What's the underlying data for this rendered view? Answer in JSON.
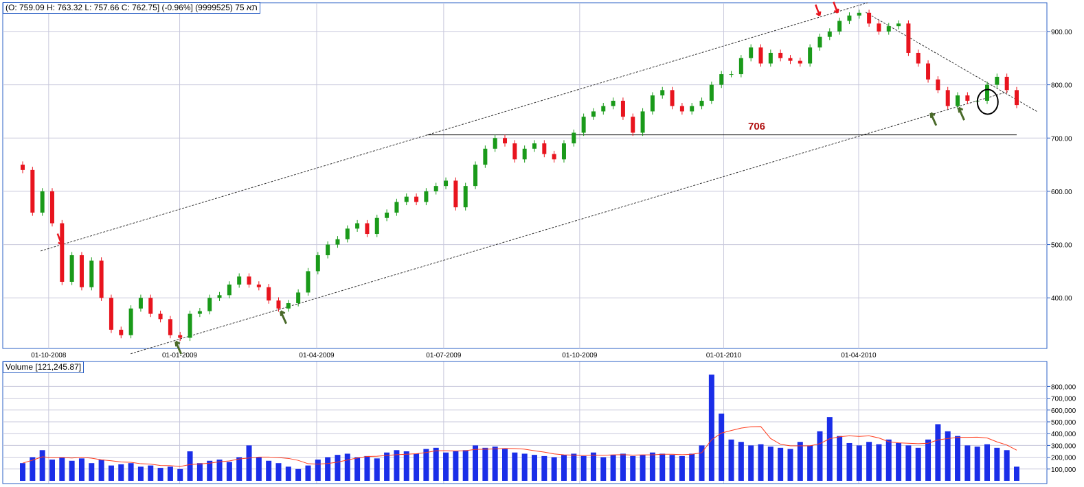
{
  "header": {
    "ohlc_readout": "(O: 759.09  H: 763.32  L: 757.66  C: 762.75] (-0.96%] (9999525) 75 תא"
  },
  "volume_panel": {
    "label": "Volume [121,245.87]"
  },
  "colors": {
    "up": "#1a9a1a",
    "down": "#e8141e",
    "grid": "#c8c8dc",
    "frame": "#2a5fc4",
    "volume": "#1a2ee8",
    "ma": "#ff3a1a",
    "annot": "#b01010"
  },
  "chart_data": [
    {
      "type": "candlestick",
      "title": "",
      "x_unit": "week index",
      "ylim": [
        305,
        954
      ],
      "xlim": [
        0,
        99.4
      ],
      "grid": true,
      "y_ticks": [
        400,
        500,
        600,
        700,
        800,
        900
      ],
      "y_tick_labels": [
        "400.00",
        "500.00",
        "600.00",
        "700.00",
        "800.00",
        "900.00"
      ],
      "x_ticks": [
        {
          "at": 2.6,
          "label": "01-10-2008"
        },
        {
          "at": 15.7,
          "label": "01-01-2009"
        },
        {
          "at": 29.4,
          "label": "01-04-2009"
        },
        {
          "at": 42.1,
          "label": "01-07-2009"
        },
        {
          "at": 55.7,
          "label": "01-10-2009"
        },
        {
          "at": 70.1,
          "label": "01-01-2010"
        },
        {
          "at": 83.6,
          "label": "01-04-2010"
        }
      ],
      "closes": [
        640,
        560,
        600,
        540,
        430,
        480,
        420,
        470,
        400,
        340,
        330,
        380,
        400,
        370,
        360,
        330,
        325,
        370,
        375,
        400,
        405,
        425,
        440,
        425,
        420,
        395,
        380,
        390,
        410,
        450,
        480,
        500,
        510,
        530,
        540,
        520,
        550,
        560,
        580,
        590,
        580,
        600,
        610,
        620,
        570,
        610,
        650,
        680,
        700,
        690,
        660,
        680,
        690,
        670,
        660,
        690,
        710,
        740,
        750,
        760,
        770,
        740,
        710,
        750,
        780,
        790,
        760,
        750,
        760,
        770,
        800,
        820,
        820,
        850,
        870,
        840,
        860,
        850,
        845,
        840,
        870,
        890,
        900,
        920,
        930,
        935,
        915,
        900,
        910,
        915,
        860,
        840,
        810,
        790,
        760,
        780,
        770,
        770,
        800,
        815,
        790,
        762
      ],
      "lines": [
        {
          "name": "upper-channel",
          "from": [
            1.8,
            488
          ],
          "to": [
            84.5,
            954
          ]
        },
        {
          "name": "lower-channel",
          "from": [
            10.8,
            295
          ],
          "to": [
            98.5,
            787
          ]
        },
        {
          "name": "descending-resistance",
          "from": [
            84.3,
            936
          ],
          "to": [
            101.5,
            749
          ]
        },
        {
          "name": "support-706",
          "from": [
            40.5,
            706
          ],
          "to": [
            99.4,
            706
          ]
        }
      ],
      "annotations": [
        {
          "text": "706",
          "at": [
            73.4,
            716
          ]
        }
      ],
      "arrows": [
        {
          "color": "down",
          "at": [
            3.9,
            500
          ]
        },
        {
          "color": "down",
          "at": [
            79.7,
            930
          ]
        },
        {
          "color": "down",
          "at": [
            81.5,
            935
          ]
        },
        {
          "color": "up",
          "at": [
            15.3,
            323
          ]
        },
        {
          "color": "up",
          "at": [
            25.8,
            380
          ]
        },
        {
          "color": "up",
          "at": [
            90.8,
            752
          ]
        },
        {
          "color": "up",
          "at": [
            93.6,
            762
          ]
        }
      ],
      "circle_at": [
        96.5,
        768
      ]
    },
    {
      "type": "bar",
      "title": "Volume",
      "ylim": [
        0,
        900000
      ],
      "y_ticks": [
        100000,
        200000,
        300000,
        400000,
        500000,
        600000,
        700000,
        800000
      ],
      "y_tick_labels": [
        "100,000",
        "200,000",
        "300,000",
        "400,000",
        "500,000",
        "600,000",
        "700,000",
        "800,000"
      ],
      "values": [
        150,
        200,
        260,
        180,
        200,
        170,
        190,
        150,
        180,
        130,
        140,
        150,
        120,
        130,
        110,
        120,
        100,
        250,
        150,
        170,
        180,
        160,
        200,
        300,
        200,
        170,
        150,
        120,
        100,
        130,
        180,
        200,
        220,
        230,
        200,
        210,
        190,
        240,
        260,
        250,
        230,
        270,
        280,
        240,
        250,
        260,
        300,
        280,
        290,
        270,
        240,
        230,
        220,
        210,
        200,
        220,
        230,
        210,
        240,
        200,
        220,
        230,
        210,
        220,
        240,
        230,
        220,
        210,
        230,
        300,
        900,
        570,
        350,
        330,
        300,
        310,
        290,
        280,
        270,
        330,
        300,
        420,
        540,
        380,
        320,
        300,
        330,
        310,
        350,
        320,
        300,
        280,
        350,
        480,
        420,
        380,
        300,
        290,
        310,
        280,
        260,
        120
      ],
      "moving_average_color": "ma"
    }
  ]
}
